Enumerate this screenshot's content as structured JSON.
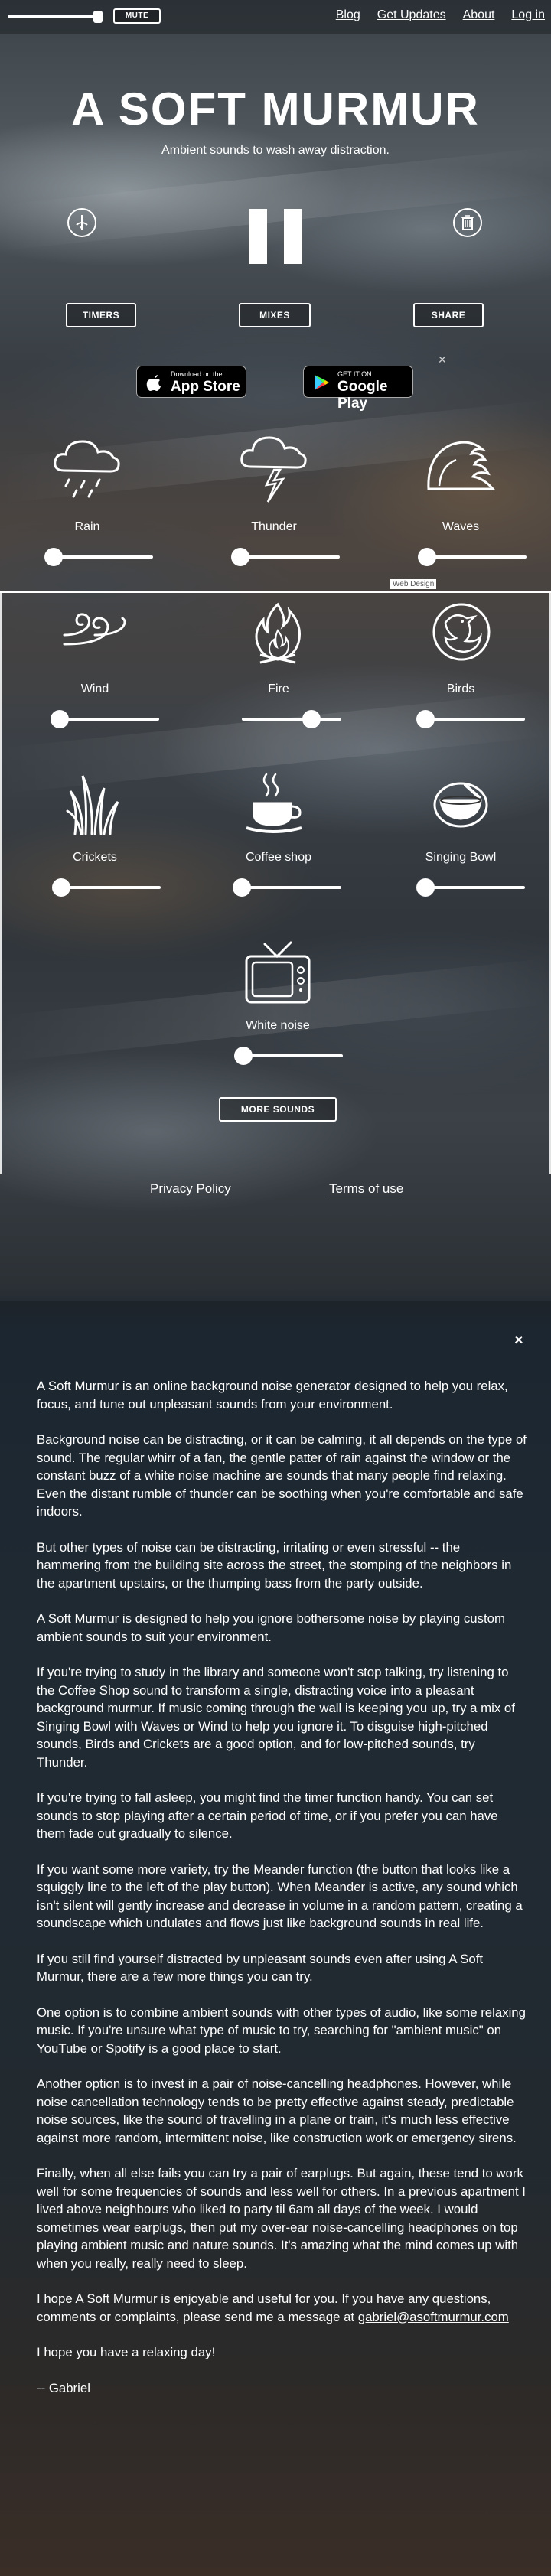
{
  "topbar": {
    "master_volume": 0.92,
    "mute_label": "MUTE",
    "nav": [
      "Blog",
      "Get Updates",
      "About",
      "Log in"
    ]
  },
  "header": {
    "title": "A SOFT MURMUR",
    "tagline": "Ambient sounds to wash away distraction."
  },
  "controls": {
    "timers": "TIMERS",
    "mixes": "MIXES",
    "share": "SHARE",
    "play_state": "paused"
  },
  "stores": {
    "apple_small": "Download on the",
    "apple_big": "App Store",
    "google_small": "GET IT ON",
    "google_big": "Google Play"
  },
  "sounds": [
    {
      "label": "Rain",
      "icon": "rain-cloud-icon",
      "level": 0.0
    },
    {
      "label": "Thunder",
      "icon": "thunder-cloud-icon",
      "level": 0.0
    },
    {
      "label": "Waves",
      "icon": "waves-icon",
      "level": 0.0
    },
    {
      "label": "Wind",
      "icon": "wind-icon",
      "level": 0.0
    },
    {
      "label": "Fire",
      "icon": "fire-icon",
      "level": 0.7
    },
    {
      "label": "Birds",
      "icon": "bird-icon",
      "level": 0.0
    },
    {
      "label": "Crickets",
      "icon": "grass-icon",
      "level": 0.0
    },
    {
      "label": "Coffee shop",
      "icon": "coffee-cup-icon",
      "level": 0.0
    },
    {
      "label": "Singing Bowl",
      "icon": "singing-bowl-icon",
      "level": 0.0
    },
    {
      "label": "White noise",
      "icon": "tv-icon",
      "level": 0.0
    }
  ],
  "more_sounds": "MORE SOUNDS",
  "web_design": "Web Design",
  "footer_links": {
    "privacy": "Privacy Policy",
    "terms": "Terms of use"
  },
  "about": {
    "close": "×",
    "paragraphs": [
      "A Soft Murmur is an online background noise generator designed to help you relax, focus, and tune out unpleasant sounds from your environment.",
      "Background noise can be distracting, or it can be calming, it all depends on the type of sound. The regular whirr of a fan, the gentle patter of rain against the window or the constant buzz of a white noise machine are sounds that many people find relaxing. Even the distant rumble of thunder can be soothing when you're comfortable and safe indoors.",
      "But other types of noise can be distracting, irritating or even stressful -- the hammering from the building site across the street, the stomping of the neighbors in the apartment upstairs, or the thumping bass from the party outside.",
      "A Soft Murmur is designed to help you ignore bothersome noise by playing custom ambient sounds to suit your environment.",
      "If you're trying to study in the library and someone won't stop talking, try listening to the Coffee Shop sound to transform a single, distracting voice into a pleasant background murmur. If music coming through the wall is keeping you up, try a mix of Singing Bowl with Waves or Wind to help you ignore it. To disguise high-pitched sounds, Birds and Crickets are a good option, and for low-pitched sounds, try Thunder.",
      "If you're trying to fall asleep, you might find the timer function handy. You can set sounds to stop playing after a certain period of time, or if you prefer you can have them fade out gradually to silence.",
      "If you want some more variety, try the Meander function (the button that looks like a squiggly line to the left of the play button). When Meander is active, any sound which isn't silent will gently increase and decrease in volume in a random pattern, creating a soundscape which undulates and flows just like background sounds in real life.",
      "If you still find yourself distracted by unpleasant sounds even after using A Soft Murmur, there are a few more things you can try.",
      "One option is to combine ambient sounds with other types of audio, like some relaxing music. If you're unsure what type of music to try, searching for \"ambient music\" on YouTube or Spotify is a good place to start.",
      "Another option is to invest in a pair of noise-cancelling headphones. However, while noise cancellation technology tends to be pretty effective against steady, predictable noise sources, like the sound of travelling in a plane or train, it's much less effective against more random, intermittent noise, like construction work or emergency sirens.",
      "Finally, when all else fails you can try a pair of earplugs. But again, these tend to work well for some frequencies of sounds and less well for others. In a previous apartment I lived above neighbours who liked to party til 6am all days of the week. I would sometimes wear earplugs, then put my over-ear noise-cancelling headphones on top playing ambient music and nature sounds. It's amazing what the mind comes up with when you really, really need to sleep.",
      "I hope A Soft Murmur is enjoyable and useful for you. If you have any questions, comments or complaints, please send me a message at",
      "I hope you have a relaxing day!",
      "-- Gabriel"
    ],
    "email": "gabriel@asoftmurmur.com"
  }
}
